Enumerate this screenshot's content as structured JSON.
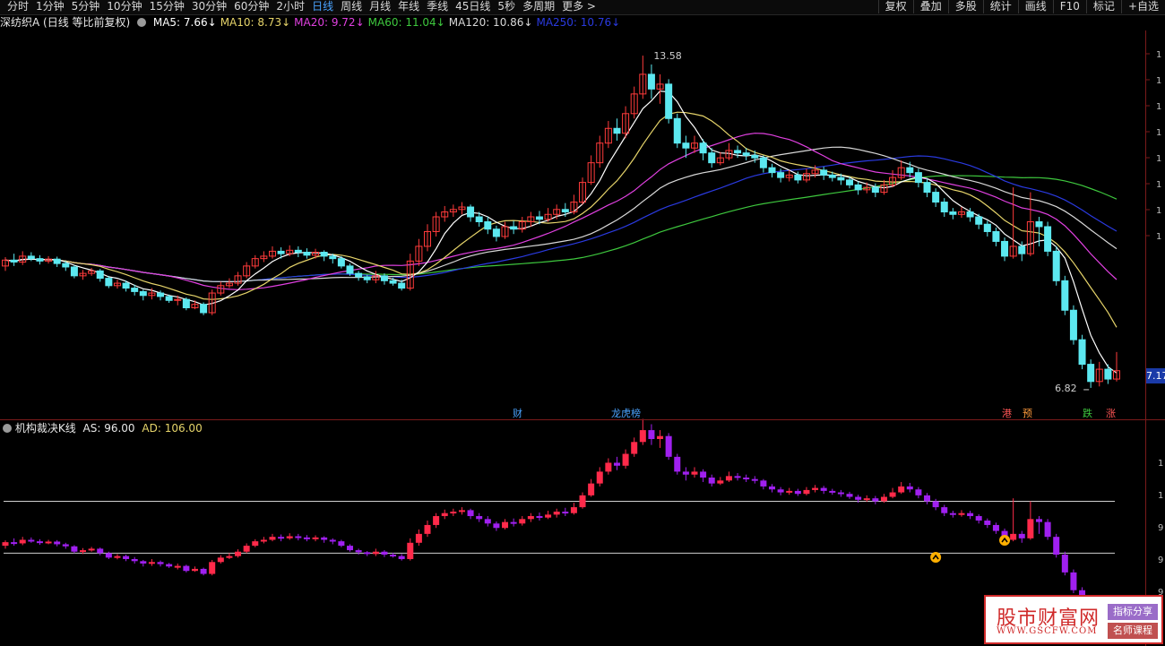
{
  "topbar": {
    "periods": [
      "分时",
      "1分钟",
      "5分钟",
      "10分钟",
      "15分钟",
      "30分钟",
      "60分钟",
      "2小时",
      "日线",
      "周线",
      "月线",
      "年线",
      "季线",
      "45日线",
      "5秒",
      "多周期",
      "更多 >"
    ],
    "active_period": "日线",
    "tools": [
      "复权",
      "叠加",
      "多股",
      "统计",
      "画线",
      "F10",
      "标记",
      "+自选"
    ]
  },
  "main_chart": {
    "title": "深纺织A (日线 等比前复权)",
    "ma": [
      {
        "label": "MA5: 7.66",
        "color": "#ffffff",
        "arrow": "↓"
      },
      {
        "label": "MA10: 8.73",
        "color": "#e6d46a",
        "arrow": "↓"
      },
      {
        "label": "MA20: 9.72",
        "color": "#e040e0",
        "arrow": "↓"
      },
      {
        "label": "MA60: 11.04",
        "color": "#3ec83e",
        "arrow": "↓"
      },
      {
        "label": "MA120: 10.86",
        "color": "#d8d8d8",
        "arrow": "↓"
      },
      {
        "label": "MA250: 10.76",
        "color": "#2a3ae0",
        "arrow": "↓"
      }
    ],
    "high_label": "13.58",
    "low_label": "6.82",
    "last_price": "7.17",
    "event_marks": [
      {
        "text": "财",
        "color": "#4aa3ff"
      },
      {
        "text": "龙虎榜",
        "color": "#4aa3ff"
      },
      {
        "text": "港",
        "color": "#ff5555"
      },
      {
        "text": "预",
        "color": "#ff9a3c"
      },
      {
        "text": "跌",
        "color": "#3ec83e"
      },
      {
        "text": "涨",
        "color": "#ff5555"
      }
    ],
    "colors": {
      "up": "#ff3b3b",
      "down": "#5ce8f0"
    }
  },
  "indicator": {
    "name": "机构裁决K线",
    "as_label": "AS: 96.00",
    "ad_label": "AD: 106.00",
    "colors": {
      "up": "#ff2a4a",
      "down": "#a020f0",
      "signal": "#ffb000"
    }
  },
  "ad_watermark": {
    "name": "股市财富网",
    "url": "WWW.GSCFW.COM",
    "tag1": "指标分享",
    "tag2": "名师课程",
    "tag1_color": "#9a6cc8",
    "tag2_color": "#c05050"
  },
  "chart_data": {
    "type": "candlestick",
    "note_high": 13.58,
    "note_low": 6.82,
    "last": 7.17,
    "candles": [
      [
        9.3,
        9.42,
        9.48,
        9.2
      ],
      [
        9.42,
        9.38,
        9.55,
        9.3
      ],
      [
        9.38,
        9.5,
        9.6,
        9.32
      ],
      [
        9.5,
        9.45,
        9.58,
        9.4
      ],
      [
        9.45,
        9.4,
        9.52,
        9.33
      ],
      [
        9.4,
        9.44,
        9.5,
        9.35
      ],
      [
        9.44,
        9.35,
        9.49,
        9.28
      ],
      [
        9.35,
        9.28,
        9.4,
        9.2
      ],
      [
        9.28,
        9.1,
        9.32,
        9.05
      ],
      [
        9.1,
        9.15,
        9.22,
        9.02
      ],
      [
        9.15,
        9.2,
        9.26,
        9.1
      ],
      [
        9.2,
        9.05,
        9.24,
        8.98
      ],
      [
        9.05,
        8.9,
        9.1,
        8.85
      ],
      [
        8.9,
        8.95,
        9.02,
        8.84
      ],
      [
        8.95,
        8.85,
        9.0,
        8.78
      ],
      [
        8.85,
        8.78,
        8.92,
        8.7
      ],
      [
        8.78,
        8.7,
        8.82,
        8.6
      ],
      [
        8.7,
        8.75,
        8.85,
        8.62
      ],
      [
        8.75,
        8.68,
        8.8,
        8.6
      ],
      [
        8.68,
        8.6,
        8.72,
        8.55
      ],
      [
        8.6,
        8.62,
        8.7,
        8.5
      ],
      [
        8.62,
        8.45,
        8.66,
        8.4
      ],
      [
        8.45,
        8.52,
        8.6,
        8.42
      ],
      [
        8.52,
        8.35,
        8.56,
        8.3
      ],
      [
        8.35,
        8.75,
        8.82,
        8.3
      ],
      [
        8.75,
        8.9,
        8.98,
        8.7
      ],
      [
        8.9,
        8.95,
        9.05,
        8.85
      ],
      [
        8.95,
        9.1,
        9.18,
        8.9
      ],
      [
        9.1,
        9.3,
        9.38,
        9.05
      ],
      [
        9.3,
        9.45,
        9.52,
        9.25
      ],
      [
        9.45,
        9.5,
        9.6,
        9.38
      ],
      [
        9.5,
        9.6,
        9.7,
        9.45
      ],
      [
        9.6,
        9.55,
        9.68,
        9.45
      ],
      [
        9.55,
        9.62,
        9.72,
        9.5
      ],
      [
        9.62,
        9.58,
        9.7,
        9.48
      ],
      [
        9.58,
        9.52,
        9.66,
        9.45
      ],
      [
        9.52,
        9.58,
        9.65,
        9.45
      ],
      [
        9.58,
        9.5,
        9.62,
        9.4
      ],
      [
        9.5,
        9.45,
        9.55,
        9.35
      ],
      [
        9.45,
        9.3,
        9.5,
        9.25
      ],
      [
        9.3,
        9.15,
        9.35,
        9.1
      ],
      [
        9.15,
        9.08,
        9.2,
        9.0
      ],
      [
        9.08,
        9.02,
        9.12,
        8.95
      ],
      [
        9.02,
        9.1,
        9.2,
        8.95
      ],
      [
        9.1,
        9.0,
        9.15,
        8.92
      ],
      [
        9.0,
        8.95,
        9.06,
        8.9
      ],
      [
        8.95,
        8.85,
        9.02,
        8.8
      ],
      [
        8.85,
        9.4,
        9.55,
        8.8
      ],
      [
        9.4,
        9.7,
        9.85,
        9.3
      ],
      [
        9.7,
        10.0,
        10.15,
        9.6
      ],
      [
        10.0,
        10.3,
        10.4,
        9.9
      ],
      [
        10.3,
        10.4,
        10.52,
        10.2
      ],
      [
        10.4,
        10.45,
        10.55,
        10.3
      ],
      [
        10.45,
        10.5,
        10.6,
        10.35
      ],
      [
        10.5,
        10.3,
        10.55,
        10.2
      ],
      [
        10.3,
        10.2,
        10.4,
        10.1
      ],
      [
        10.2,
        10.05,
        10.3,
        9.95
      ],
      [
        10.05,
        9.9,
        10.12,
        9.8
      ],
      [
        9.9,
        10.1,
        10.2,
        9.85
      ],
      [
        10.1,
        10.05,
        10.22,
        9.95
      ],
      [
        10.05,
        10.2,
        10.3,
        9.98
      ],
      [
        10.2,
        10.3,
        10.4,
        10.1
      ],
      [
        10.3,
        10.25,
        10.42,
        10.15
      ],
      [
        10.25,
        10.35,
        10.48,
        10.2
      ],
      [
        10.35,
        10.45,
        10.55,
        10.25
      ],
      [
        10.45,
        10.4,
        10.58,
        10.3
      ],
      [
        10.4,
        10.6,
        10.75,
        10.35
      ],
      [
        10.6,
        11.0,
        11.1,
        10.55
      ],
      [
        11.0,
        11.4,
        11.55,
        10.95
      ],
      [
        11.4,
        11.8,
        11.95,
        11.3
      ],
      [
        11.8,
        12.1,
        12.25,
        11.7
      ],
      [
        12.1,
        12.0,
        12.3,
        11.85
      ],
      [
        12.0,
        12.4,
        12.55,
        11.9
      ],
      [
        12.4,
        12.8,
        12.95,
        12.3
      ],
      [
        12.8,
        13.2,
        13.58,
        12.7
      ],
      [
        13.2,
        12.9,
        13.4,
        12.7
      ],
      [
        12.9,
        13.0,
        13.2,
        12.6
      ],
      [
        13.0,
        12.3,
        13.1,
        12.2
      ],
      [
        12.3,
        11.8,
        12.4,
        11.7
      ],
      [
        11.8,
        11.7,
        11.95,
        11.5
      ],
      [
        11.7,
        11.8,
        11.95,
        11.6
      ],
      [
        11.8,
        11.6,
        11.88,
        11.45
      ],
      [
        11.6,
        11.4,
        11.7,
        11.3
      ],
      [
        11.4,
        11.5,
        11.62,
        11.35
      ],
      [
        11.5,
        11.65,
        11.8,
        11.45
      ],
      [
        11.65,
        11.6,
        11.75,
        11.5
      ],
      [
        11.6,
        11.55,
        11.7,
        11.45
      ],
      [
        11.55,
        11.5,
        11.65,
        11.4
      ],
      [
        11.5,
        11.3,
        11.55,
        11.2
      ],
      [
        11.3,
        11.2,
        11.38,
        11.1
      ],
      [
        11.2,
        11.1,
        11.28,
        11.0
      ],
      [
        11.1,
        11.15,
        11.25,
        11.02
      ],
      [
        11.15,
        11.05,
        11.22,
        10.98
      ],
      [
        11.05,
        11.18,
        11.28,
        11.0
      ],
      [
        11.18,
        11.25,
        11.35,
        11.1
      ],
      [
        11.25,
        11.15,
        11.32,
        11.05
      ],
      [
        11.15,
        11.1,
        11.22,
        11.02
      ],
      [
        11.1,
        11.05,
        11.18,
        10.95
      ],
      [
        11.05,
        10.95,
        11.12,
        10.88
      ],
      [
        10.95,
        10.85,
        11.02,
        10.75
      ],
      [
        10.85,
        10.9,
        11.0,
        10.78
      ],
      [
        10.9,
        10.8,
        10.98,
        10.7
      ],
      [
        10.8,
        10.95,
        11.05,
        10.75
      ],
      [
        10.95,
        11.1,
        11.25,
        10.9
      ],
      [
        11.1,
        11.3,
        11.45,
        11.05
      ],
      [
        11.3,
        11.2,
        11.42,
        11.1
      ],
      [
        11.2,
        11.0,
        11.28,
        10.9
      ],
      [
        11.0,
        10.8,
        11.08,
        10.7
      ],
      [
        10.8,
        10.6,
        10.88,
        10.5
      ],
      [
        10.6,
        10.4,
        10.68,
        10.3
      ],
      [
        10.4,
        10.35,
        10.48,
        10.25
      ],
      [
        10.35,
        10.4,
        10.5,
        10.28
      ],
      [
        10.4,
        10.3,
        10.48,
        10.2
      ],
      [
        10.3,
        10.15,
        10.36,
        10.05
      ],
      [
        10.15,
        10.0,
        10.22,
        9.9
      ],
      [
        10.0,
        9.8,
        10.08,
        9.7
      ],
      [
        9.8,
        9.5,
        9.88,
        9.4
      ],
      [
        9.5,
        9.7,
        10.9,
        9.45
      ],
      [
        9.7,
        9.55,
        9.8,
        9.4
      ],
      [
        9.55,
        10.2,
        10.8,
        9.5
      ],
      [
        10.2,
        10.1,
        10.3,
        9.7
      ],
      [
        10.1,
        9.6,
        10.2,
        9.5
      ],
      [
        9.6,
        9.0,
        9.7,
        8.9
      ],
      [
        9.0,
        8.4,
        9.1,
        8.3
      ],
      [
        8.4,
        7.8,
        8.5,
        7.7
      ],
      [
        7.8,
        7.3,
        7.9,
        7.2
      ],
      [
        7.3,
        6.95,
        7.4,
        6.82
      ],
      [
        6.95,
        7.2,
        7.35,
        6.85
      ],
      [
        7.2,
        7.0,
        7.3,
        6.9
      ],
      [
        7.0,
        7.17,
        7.55,
        6.95
      ]
    ],
    "as_level": 96.0,
    "ad_level": 106.0
  }
}
